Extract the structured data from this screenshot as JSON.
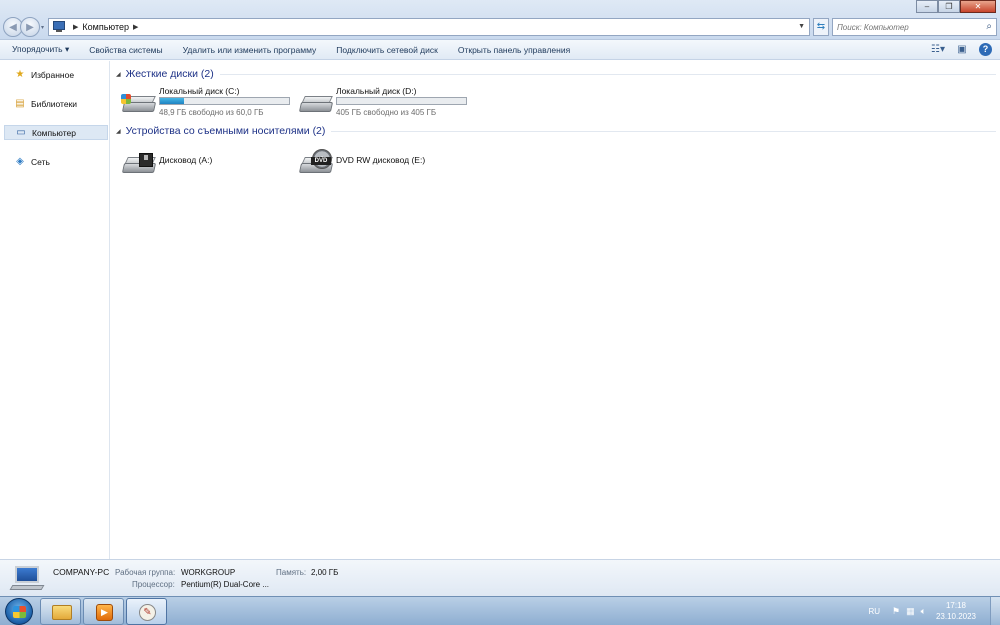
{
  "address": {
    "location": "Компьютер",
    "search_placeholder": "Поиск: Компьютер"
  },
  "toolbar": {
    "organize": "Упорядочить ▾",
    "system_properties": "Свойства системы",
    "uninstall": "Удалить или изменить программу",
    "map_drive": "Подключить сетевой диск",
    "control_panel": "Открыть панель управления"
  },
  "sidebar": {
    "items": [
      {
        "label": "Избранное",
        "icon": "star-icon"
      },
      {
        "label": "Библиотеки",
        "icon": "library-icon"
      },
      {
        "label": "Компьютер",
        "icon": "computer-icon",
        "selected": true
      },
      {
        "label": "Сеть",
        "icon": "network-icon"
      }
    ]
  },
  "groups": {
    "hard_disks": {
      "title": "Жесткие диски (2)",
      "drives": [
        {
          "name": "Локальный диск (C:)",
          "info": "48,9 ГБ свободно из 60,0 ГБ",
          "used_fraction": 0.185
        },
        {
          "name": "Локальный диск (D:)",
          "info": "405 ГБ свободно из 405 ГБ",
          "used_fraction": 0.0
        }
      ]
    },
    "removable": {
      "title": "Устройства со съемными носителями (2)",
      "drives": [
        {
          "name": "Дисковод (A:)",
          "icon": "floppy-drive-icon"
        },
        {
          "name": "DVD RW дисковод (E:)",
          "icon": "dvd-drive-icon",
          "badge": "DVD"
        }
      ]
    }
  },
  "details": {
    "computer_name": "COMPANY-PC",
    "workgroup_label": "Рабочая группа:",
    "workgroup_value": "WORKGROUP",
    "memory_label": "Память:",
    "memory_value": "2,00 ГБ",
    "cpu_label": "Процессор:",
    "cpu_value": "Pentium(R) Dual-Core ..."
  },
  "taskbar": {
    "language": "RU",
    "time": "17:18",
    "date": "23.10.2023"
  },
  "colors": {
    "group_title": "#1e3287",
    "disk_fill": "#2a9ad6",
    "taskbar": "#a3bfdd"
  }
}
